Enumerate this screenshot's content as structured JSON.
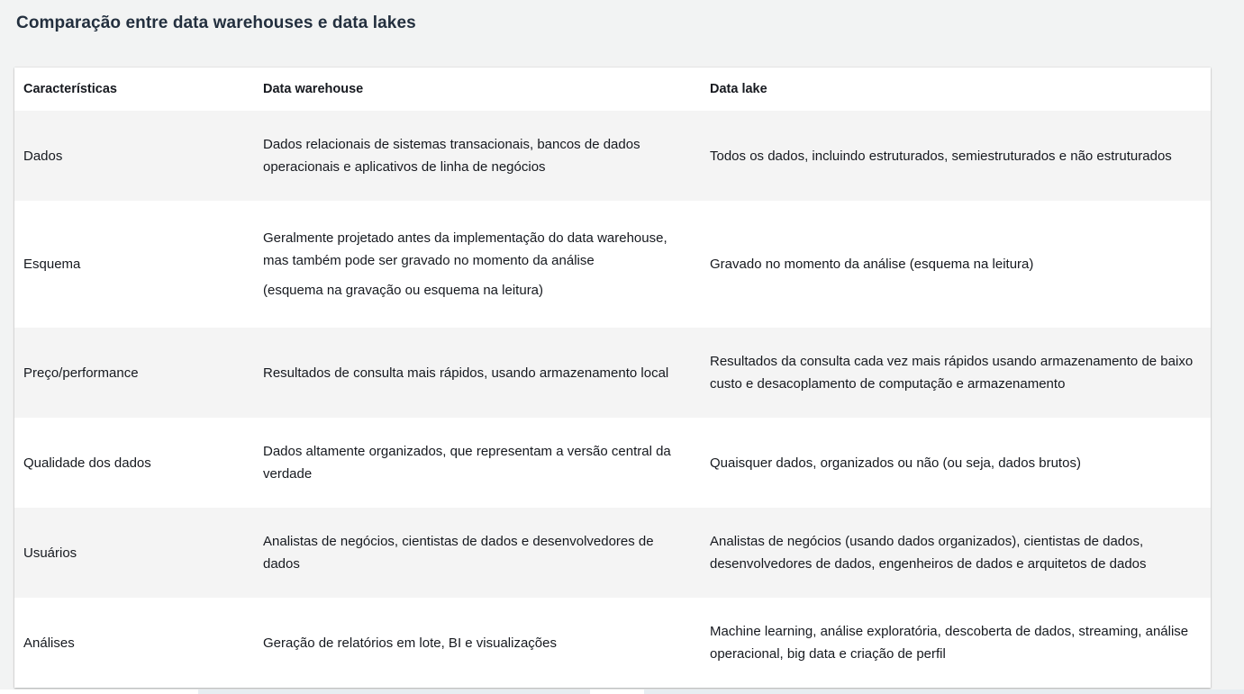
{
  "page": {
    "title": "Comparação entre data warehouses e data lakes"
  },
  "table": {
    "headers": [
      "Características",
      "Data warehouse",
      "Data lake"
    ],
    "rows": [
      {
        "feature": "Dados",
        "warehouse": [
          "Dados relacionais de sistemas transacionais, bancos de dados operacionais e aplicativos de linha de negócios"
        ],
        "lake": [
          "Todos os dados, incluindo estruturados, semiestruturados e não estruturados"
        ]
      },
      {
        "feature": "Esquema",
        "warehouse": [
          "Geralmente projetado antes da implementação do data warehouse, mas também pode ser gravado no momento da análise",
          "(esquema na gravação ou esquema na leitura)"
        ],
        "lake": [
          "Gravado no momento da análise (esquema na leitura)"
        ]
      },
      {
        "feature": "Preço/performance",
        "warehouse": [
          "Resultados de consulta mais rápidos, usando armazenamento local"
        ],
        "lake": [
          "Resultados da consulta cada vez mais rápidos usando armazenamento de baixo custo e desacoplamento de computação e armazenamento"
        ]
      },
      {
        "feature": "Qualidade dos dados",
        "warehouse": [
          "Dados altamente organizados, que representam a versão central da verdade"
        ],
        "lake": [
          "Quaisquer dados, organizados ou não (ou seja, dados brutos)"
        ]
      },
      {
        "feature": "Usuários",
        "warehouse": [
          "Analistas de negócios, cientistas de dados e desenvolvedores de dados"
        ],
        "lake": [
          "Analistas de negócios (usando dados organizados), cientistas de dados, desenvolvedores de dados, engenheiros de dados e arquitetos de dados"
        ]
      },
      {
        "feature": "Análises",
        "warehouse": [
          "Geração de relatórios em lote, BI e visualizações"
        ],
        "lake": [
          "Machine learning, análise exploratória, descoberta de dados, streaming, análise operacional, big data e criação de perfil"
        ]
      }
    ]
  }
}
